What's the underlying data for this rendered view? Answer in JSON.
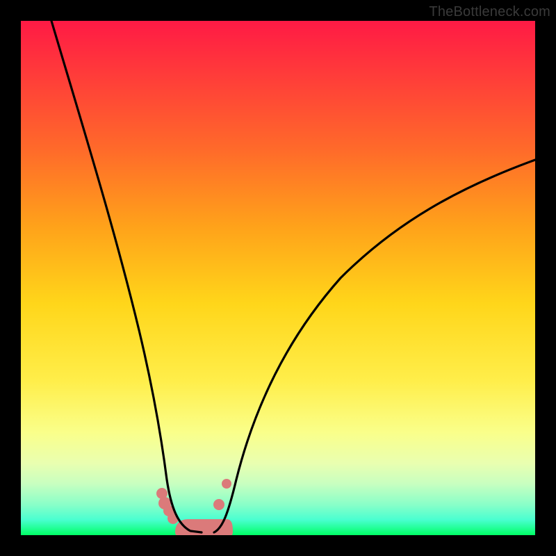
{
  "watermark": "TheBottleneck.com",
  "chart_data": {
    "type": "line",
    "title": "",
    "subtitle": "",
    "xlabel": "",
    "ylabel": "",
    "xlim": [
      0,
      100
    ],
    "ylim": [
      0,
      100
    ],
    "grid": false,
    "legend": null,
    "series": [
      {
        "name": "left-branch",
        "x": [
          6,
          10,
          14,
          18,
          22,
          24,
          26,
          27,
          27.5,
          28,
          29,
          30,
          31.5,
          33,
          34
        ],
        "y": [
          100,
          86,
          73,
          59,
          41,
          30,
          17,
          10,
          7,
          5,
          3,
          2,
          1,
          0.5,
          0.5
        ]
      },
      {
        "name": "right-branch",
        "x": [
          37.5,
          38.5,
          39.5,
          41,
          44,
          48,
          55,
          62,
          70,
          78,
          86,
          94,
          100
        ],
        "y": [
          0.5,
          3,
          6,
          12,
          22,
          32,
          44,
          52,
          58,
          63,
          67,
          71,
          73
        ]
      }
    ],
    "annotations": [
      {
        "name": "lower-pink-band",
        "shape": "rounded-segment",
        "x_range": [
          31,
          40
        ],
        "y_range": [
          0,
          3
        ],
        "color": "#dd7a7a"
      },
      {
        "name": "left-beads",
        "shape": "dots",
        "points": [
          [
            27.5,
            8
          ],
          [
            28,
            6
          ],
          [
            28,
            5
          ],
          [
            29,
            4
          ]
        ],
        "color": "#dd7a7a"
      },
      {
        "name": "right-beads",
        "shape": "dots",
        "points": [
          [
            38.5,
            6
          ],
          [
            40,
            10
          ]
        ],
        "color": "#dd7a7a"
      }
    ],
    "background_gradient": {
      "direction": "vertical",
      "stops": [
        {
          "pos": 0,
          "color": "#ff1a45"
        },
        {
          "pos": 25,
          "color": "#ff6a2a"
        },
        {
          "pos": 55,
          "color": "#ffd61a"
        },
        {
          "pos": 80,
          "color": "#faff8a"
        },
        {
          "pos": 94,
          "color": "#8affc8"
        },
        {
          "pos": 100,
          "color": "#00ff66"
        }
      ]
    }
  }
}
